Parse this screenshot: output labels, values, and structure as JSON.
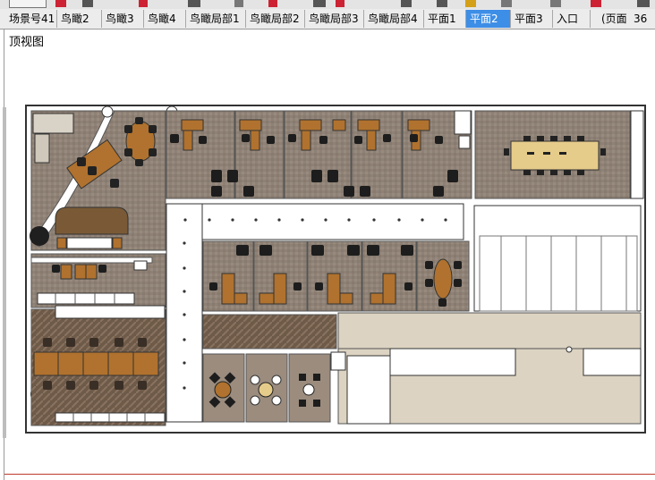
{
  "tabs": [
    {
      "label": "场景号41",
      "active": false
    },
    {
      "label": "鸟瞰2",
      "active": false
    },
    {
      "label": "鸟瞰3",
      "active": false
    },
    {
      "label": "鸟瞰4",
      "active": false
    },
    {
      "label": "鸟瞰局部1",
      "active": false
    },
    {
      "label": "鸟瞰局部2",
      "active": false
    },
    {
      "label": "鸟瞰局部3",
      "active": false
    },
    {
      "label": "鸟瞰局部4",
      "active": false
    },
    {
      "label": "平面1",
      "active": false
    },
    {
      "label": "平面2",
      "active": true
    },
    {
      "label": "平面3",
      "active": false
    },
    {
      "label": "入口",
      "active": false
    },
    {
      "label": "(页面",
      "active": false
    },
    {
      "label": "36",
      "active": false
    }
  ],
  "scene_label": "顶视图",
  "colors": {
    "active_tab": "#3d8ee6",
    "floor_carpet": "#8f8175",
    "floor_light": "#dcd3c2",
    "wood": "#b0722e",
    "wall": "#ffffff",
    "outline": "#333333"
  }
}
